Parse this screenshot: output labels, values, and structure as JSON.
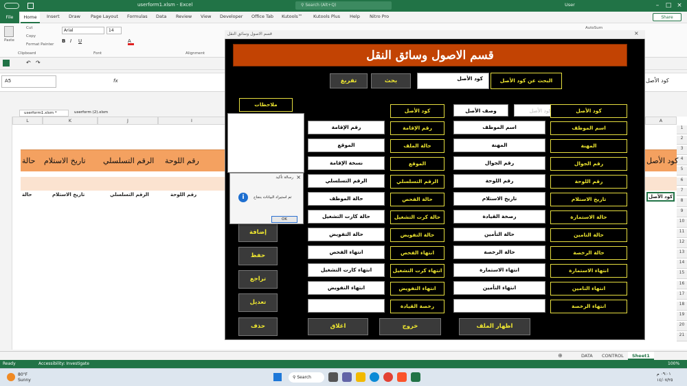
{
  "window": {
    "title": "userform1.xlsm - Excel",
    "search": "Search (Alt+Q)",
    "user": "User"
  },
  "menu": {
    "file": "File",
    "home": "Home",
    "items": [
      "Insert",
      "Draw",
      "Page Layout",
      "Formulas",
      "Data",
      "Review",
      "View",
      "Developer",
      "Office Tab",
      "Kutools™",
      "Kutools Plus",
      "Help",
      "Nitro Pro"
    ],
    "share": "Share"
  },
  "ribbon": {
    "paste": "Paste",
    "cut": "Cut",
    "copy": "Copy",
    "format_painter": "Format Painter",
    "clipboard": "Clipboard",
    "font_name": "Arial",
    "font_size": "14",
    "font": "Font",
    "alignment": "Alignment",
    "autosum": "AutoSum"
  },
  "formula_bar": {
    "name_box": "A5",
    "fx": "fx",
    "right_value": "كود الأصل"
  },
  "file_tabs": [
    "userform1.xlsm *",
    "userform (2).xlsm"
  ],
  "columns": [
    "A",
    "I",
    "J",
    "K",
    "L"
  ],
  "rows": [
    "1",
    "2",
    "3",
    "4",
    "5",
    "6",
    "7",
    "8",
    "9",
    "10",
    "11",
    "12",
    "13",
    "14",
    "15",
    "16",
    "17",
    "18",
    "19",
    "20",
    "21"
  ],
  "sheet_headers": {
    "a": "كود الأصل",
    "i": "رقم اللوحة",
    "j": "الرقم التسلسلي",
    "k": "تاريخ الاستلام",
    "l": "حالة"
  },
  "sheet_row5": {
    "a": "كود الأصل",
    "i": "رقم اللوحة",
    "j": "الرقم التسلسلي",
    "k": "تاريخ الاستلام",
    "l": "حالة"
  },
  "sheet_tabs": [
    "DATA",
    "CONTROL",
    "Sheet1"
  ],
  "status": {
    "ready": "Ready",
    "accessibility": "Accessibility: Investigate",
    "zoom": "100%"
  },
  "taskbar": {
    "weather_temp": "80°F",
    "weather_text": "Sunny",
    "search": "Search",
    "time": "٠٩:٠١ م",
    "date": "١٤/٠٧/٢٥"
  },
  "form": {
    "caption": "قسم الاصول وسائق النقل",
    "banner": "قسم الاصول وسائق النقل",
    "search_label": "البحث عن كود الأصل",
    "search_value": "كود الأصل",
    "search_btn": "بحث",
    "clear_btn": "تفريغ",
    "notes_label": "ملاحظات",
    "labels_right": [
      "كود الأصل",
      "اسم الموظف",
      "المهنة",
      "رقم الجوال",
      "رقم اللوحة",
      "تاريخ الاستلام",
      "حالة الاستمارة",
      "حالة التامين",
      "حالة الرخصة",
      "انتهاء الاستمارة",
      "انتهاء التامين",
      "انتهاء الرخصة"
    ],
    "values_mid": [
      "كود الأصل",
      "اسم الموظف",
      "المهنة",
      "رقم الجوال",
      "رقم اللوحة",
      "تاريخ الاستلام",
      "رصخة القيادة",
      "حالة التأمين",
      "حالة الرخصة",
      "انتهاء الاستمارة",
      "انتهاء التأمين",
      ""
    ],
    "labels_mid": [
      "كود الأصل",
      "رقم الإقامة",
      "حالة الملف",
      "الموقع",
      "الرقم التسلسلي",
      "حالة الفحص",
      "حالة كرت التشغيل",
      "حالة التفويض",
      "انتهاء الفحص",
      "انتهاء كرت التشغيل",
      "انتهاء التفويض",
      "رخصة القيادة"
    ],
    "values_left": [
      "رقم الإقامة",
      "الموقع",
      "نسخة الإقامة",
      "الرقم التسلسلي",
      "حالة الموظف",
      "حالة كارت التشغيل",
      "حالة التفويض",
      "انتهاء الفحص",
      "انتهاء كارت التشغيل",
      "انتهاء التفويض",
      ""
    ],
    "desc_label": "وصف الأصل",
    "btns_left": [
      "إضافة",
      "حفظ",
      "تراجع",
      "تعديل",
      "حذف"
    ],
    "btns_bottom": [
      "اغلاق",
      "خروج",
      "اظهار الملف"
    ],
    "msg_title": "رسالة تأكيد",
    "msg_text": "تم استيراد البيانات بنجاح",
    "msg_ok": "OK"
  }
}
